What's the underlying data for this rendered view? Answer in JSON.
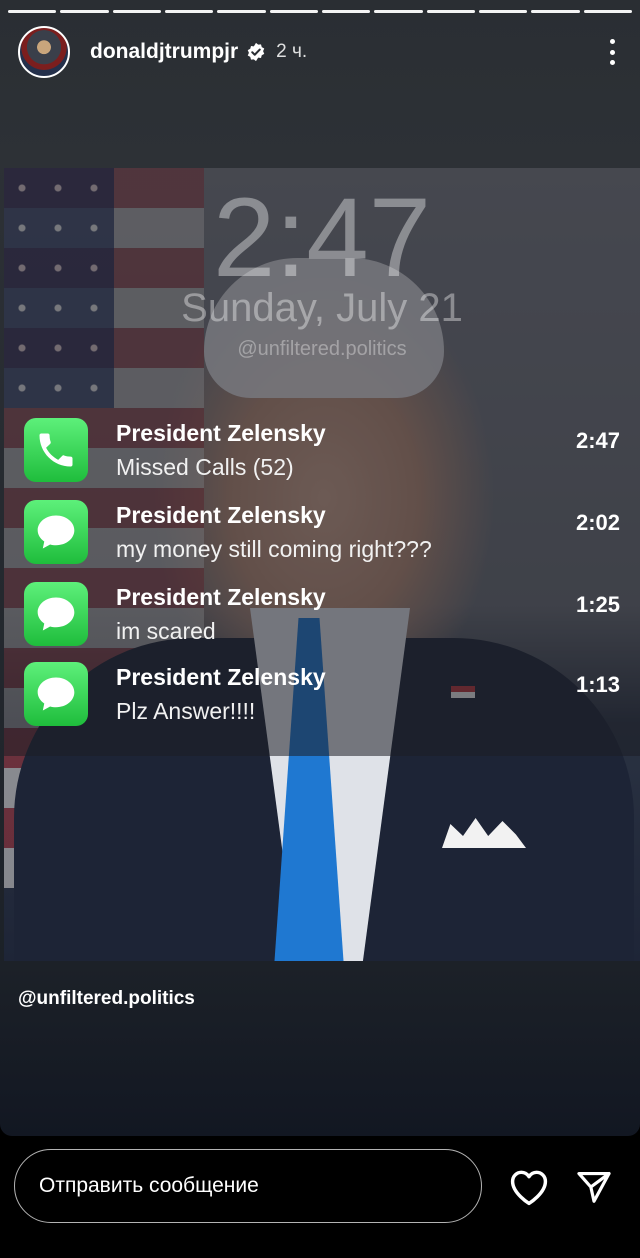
{
  "story": {
    "segments": 12,
    "header": {
      "username": "donaldjtrumpjr",
      "time_ago": "2 ч.",
      "verified_icon": "verified-badge-icon",
      "more_icon": "more-vertical-icon"
    },
    "lockscreen": {
      "time": "2:47",
      "date": "Sunday, July 21",
      "watermark": "@unfiltered.politics"
    },
    "notifications": [
      {
        "icon": "phone-icon",
        "sender": "President Zelensky",
        "message": "Missed Calls (52)",
        "time": "2:47"
      },
      {
        "icon": "message-icon",
        "sender": "President Zelensky",
        "message": "my money still coming right???",
        "time": "2:02"
      },
      {
        "icon": "message-icon",
        "sender": "President Zelensky",
        "message": "im scared",
        "time": "1:25"
      },
      {
        "icon": "message-icon",
        "sender": "President Zelensky",
        "message": "Plz Answer!!!!",
        "time": "1:13"
      }
    ],
    "caption": "@unfiltered.politics"
  },
  "reply_bar": {
    "placeholder": "Отправить сообщение",
    "like_icon": "heart-icon",
    "send_icon": "send-icon"
  },
  "colors": {
    "messages_green": "#34c759",
    "background": "#000000"
  }
}
